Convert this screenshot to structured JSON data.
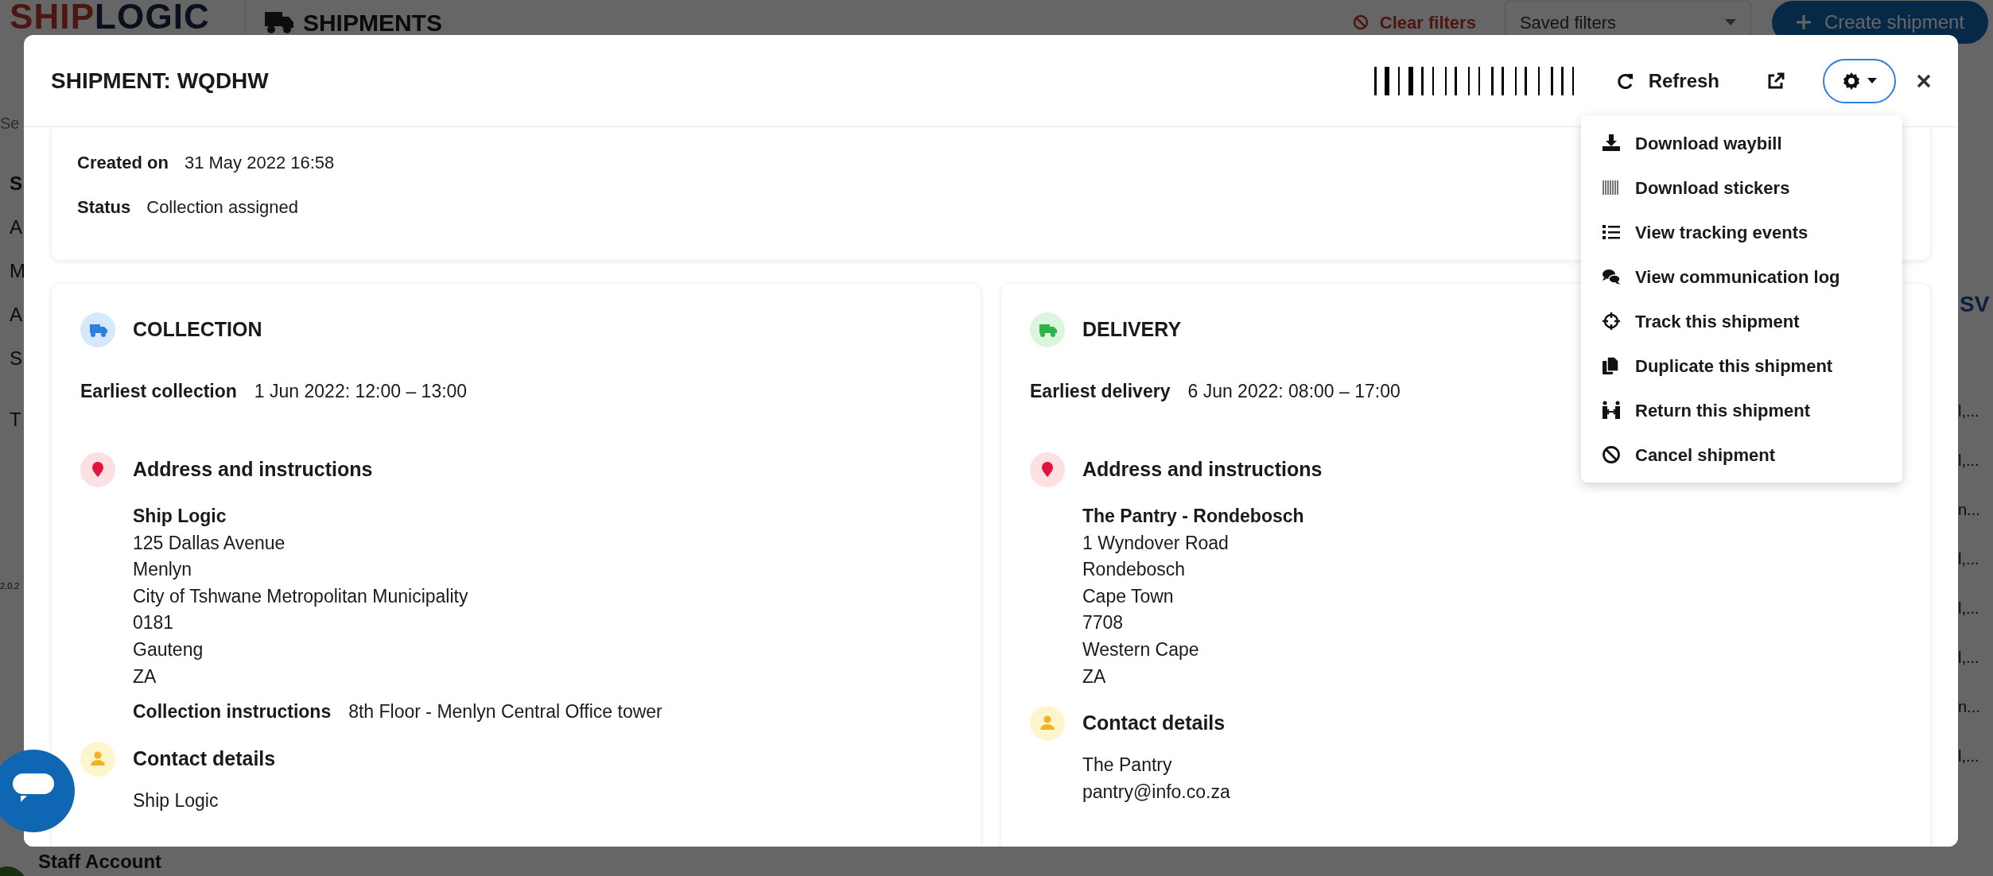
{
  "background_page": {
    "logo": {
      "part_1": "SHIP",
      "part_2": "LOGIC"
    },
    "section_title": "SHIPMENTS",
    "clear_filters": "Clear filters",
    "saved_filters": {
      "placeholder": "Saved filters"
    },
    "create_button": "Create shipment",
    "search": {
      "placeholder": "Se"
    },
    "sidebar_fragments": [
      "S",
      "A",
      "M",
      "A",
      "S",
      "T"
    ],
    "version": "2.0.2",
    "export_link": "SV",
    "row_fragments": [
      "l,...",
      "l,...",
      "n...",
      "l,...",
      "l,...",
      "l,...",
      "n...",
      "l,..."
    ],
    "user": {
      "name": "Staff Account"
    }
  },
  "modal": {
    "title": "SHIPMENT: WQDHW",
    "refresh": "Refresh",
    "menu_open": true,
    "menu": [
      {
        "label": "Download waybill",
        "kind": "download"
      },
      {
        "label": "Download stickers",
        "kind": "barcode"
      },
      {
        "label": "View tracking events",
        "kind": "list"
      },
      {
        "label": "View communication log",
        "kind": "chat"
      },
      {
        "label": "Track this shipment",
        "kind": "crosshair"
      },
      {
        "label": "Duplicate this shipment",
        "kind": "copy"
      },
      {
        "label": "Return this shipment",
        "kind": "people"
      },
      {
        "label": "Cancel shipment",
        "kind": "ban"
      }
    ],
    "summary": [
      {
        "label": "Created on",
        "value": "31 May 2022 16:58"
      },
      {
        "label": "Status",
        "value": "Collection assigned"
      }
    ],
    "sections": [
      {
        "kind": "collection",
        "title": "COLLECTION",
        "window_label": "Earliest collection",
        "window_value": "1 Jun 2022: 12:00 – 13:00",
        "address_heading": "Address and instructions",
        "address_name": "Ship Logic",
        "address_lines": [
          "125 Dallas Avenue",
          "Menlyn",
          "City of Tshwane Metropolitan Municipality",
          "0181",
          "Gauteng",
          "ZA"
        ],
        "instructions": {
          "label": "Collection instructions",
          "value": "8th Floor - Menlyn Central Office tower"
        },
        "contact_heading": "Contact details",
        "contact_lines": [
          "Ship Logic"
        ]
      },
      {
        "kind": "delivery",
        "title": "DELIVERY",
        "window_label": "Earliest delivery",
        "window_value": "6 Jun 2022: 08:00 – 17:00",
        "address_heading": "Address and instructions",
        "address_name": "The Pantry - Rondebosch",
        "address_lines": [
          "1 Wyndover Road",
          "Rondebosch",
          "Cape Town",
          "7708",
          "Western Cape",
          "ZA"
        ],
        "contact_heading": "Contact details",
        "contact_lines": [
          "The Pantry",
          "pantry@info.co.za"
        ]
      }
    ]
  }
}
